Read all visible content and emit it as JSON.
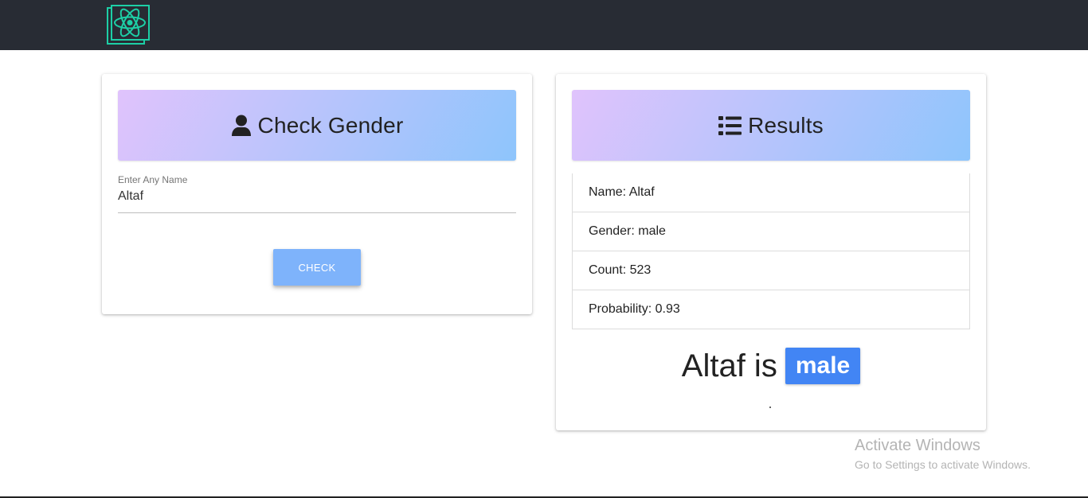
{
  "header": {
    "logo_icon": "react-atom-icon",
    "background": "#282c34",
    "logo_color": "#1dcfa6"
  },
  "check_card": {
    "title": "Check Gender",
    "title_icon": "user-icon",
    "input_label": "Enter Any Name",
    "input_value": "Altaf",
    "button_label": "CHECK",
    "button_color": "#7eb3fb"
  },
  "results_card": {
    "title": "Results",
    "title_icon": "list-icon",
    "rows": [
      {
        "text": "Name: Altaf"
      },
      {
        "text": "Gender: male"
      },
      {
        "text": "Count: 523"
      },
      {
        "text": "Probability: 0.93"
      }
    ],
    "sentence": "Altaf is",
    "gender_badge": "male",
    "badge_color": "#4285f4",
    "dot": "."
  },
  "gradient": {
    "from": "#e0c3fc",
    "to": "#8ec5fc"
  },
  "watermark": {
    "title": "Activate Windows",
    "subtitle": "Go to Settings to activate Windows."
  }
}
